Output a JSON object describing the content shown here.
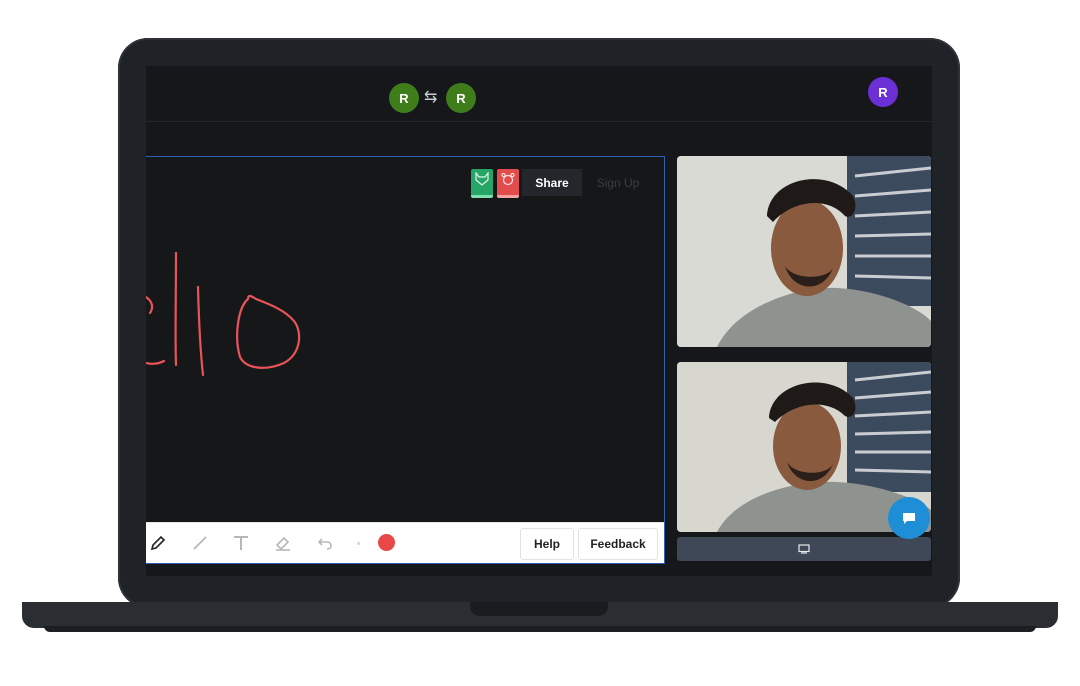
{
  "topbar": {
    "participants": [
      {
        "initial": "R",
        "color": "#3f7d1a"
      },
      {
        "initial": "R",
        "color": "#3f7d1a"
      }
    ],
    "swap_icon": "swap-arrows-icon",
    "user_avatar": {
      "initial": "R",
      "color": "#6b2fd6"
    }
  },
  "whiteboard": {
    "stroke_color": "#e8545a",
    "share_label": "Share",
    "signup_label": "Sign Up",
    "collaborators": [
      {
        "icon": "fox-avatar-icon",
        "color": "#27a567"
      },
      {
        "icon": "bear-avatar-icon",
        "color": "#e24c4c"
      }
    ]
  },
  "toolbar": {
    "tools": [
      "pencil-icon",
      "line-icon",
      "text-icon",
      "eraser-icon",
      "undo-icon"
    ],
    "active_color": "#e94848",
    "help_label": "Help",
    "feedback_label": "Feedback"
  },
  "videos": {
    "screenshare_icon": "screen-share-icon",
    "chat_icon": "chat-bubble-icon",
    "chat_color": "#1e8fd6"
  }
}
